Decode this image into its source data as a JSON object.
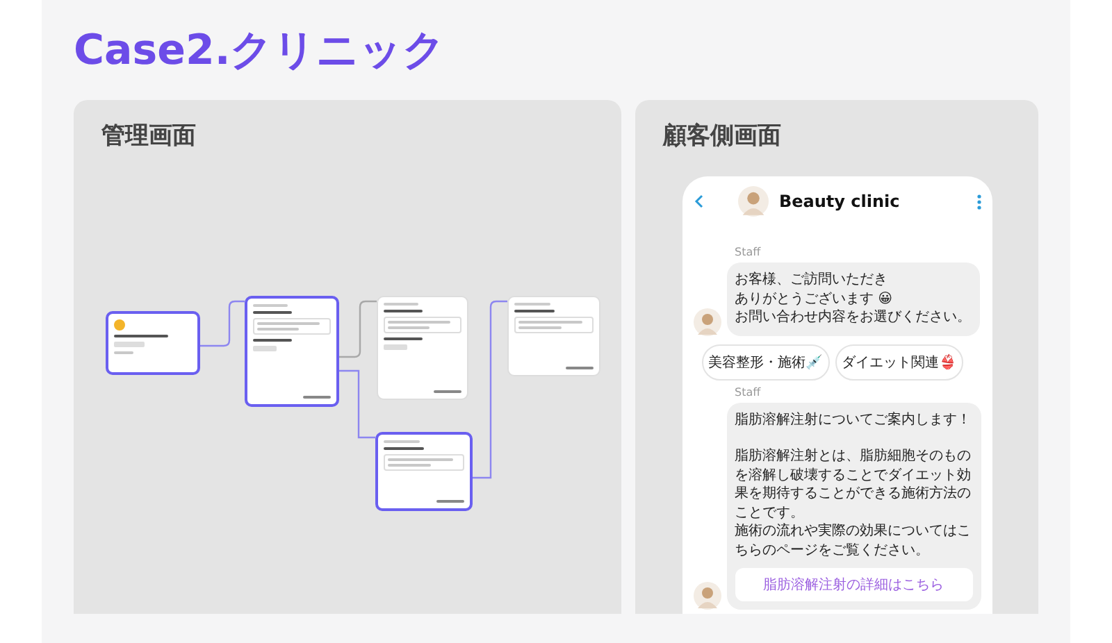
{
  "title": "Case2.クリニック",
  "admin_panel": {
    "heading": "管理画面",
    "flow_nodes": [
      {
        "selected": true
      },
      {
        "selected": true
      },
      {
        "selected": false
      },
      {
        "selected": false
      },
      {
        "selected": true
      }
    ]
  },
  "customer_panel": {
    "heading": "顧客側画面",
    "chat": {
      "title": "Beauty clinic",
      "messages": [
        {
          "kind": "text",
          "sender": "Staff",
          "paragraphs": [
            [
              "お客様、ご訪問いただき",
              "ありがとうございます 😀",
              "お問い合わせ内容をお選びください。"
            ]
          ]
        },
        {
          "kind": "choices",
          "options": [
            "美容整形・施術💉",
            "ダイエット関連👙"
          ]
        },
        {
          "kind": "text",
          "sender": "Staff",
          "paragraphs": [
            [
              "脂肪溶解注射についてご案内します！"
            ],
            [
              "脂肪溶解注射とは、脂肪細胞そのものを溶解し破壊することでダイエット効果を期待することができる施術方法のことです。",
              "施術の流れや実際の効果についてはこちらのページをご覧ください。"
            ]
          ],
          "link": "脂肪溶解注射の詳細はこちら"
        }
      ]
    }
  }
}
